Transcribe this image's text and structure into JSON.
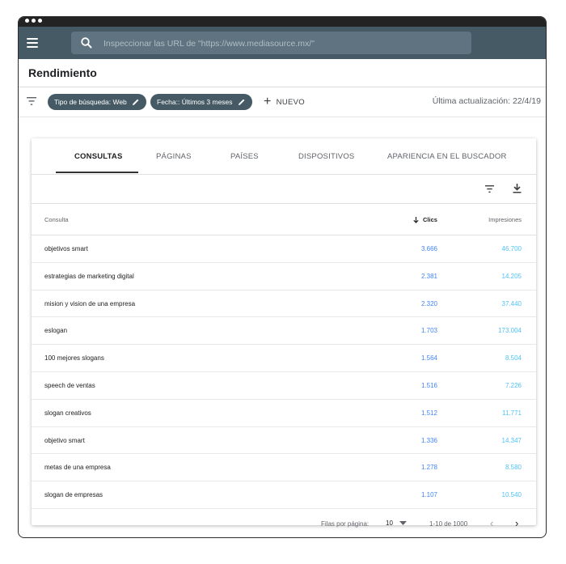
{
  "topbar": {
    "search_placeholder": "Inspeccionar las URL de \"https://www.mediasource.mx/\""
  },
  "header": {
    "title": "Rendimiento"
  },
  "filters": {
    "chips": [
      "Tipo de búsqueda: Web",
      "Fecha:: Últimos 3 meses"
    ],
    "new_label": "NUEVO",
    "last_updated": "Última actualización: 22/4/19"
  },
  "tabs": [
    "CONSULTAS",
    "PÁGINAS",
    "PAÍSES",
    "DISPOSITIVOS",
    "APARIENCIA EN EL BUSCADOR"
  ],
  "table": {
    "columns": {
      "query": "Consulta",
      "clicks": "Clics",
      "impressions": "Impresiones"
    },
    "rows": [
      {
        "query": "objetivos smart",
        "clicks": "3.666",
        "impressions": "46.700"
      },
      {
        "query": "estrategias de marketing digital",
        "clicks": "2.381",
        "impressions": "14.205"
      },
      {
        "query": "mision y vision de una empresa",
        "clicks": "2.320",
        "impressions": "37.440"
      },
      {
        "query": "eslogan",
        "clicks": "1.703",
        "impressions": "173.004"
      },
      {
        "query": "100 mejores slogans",
        "clicks": "1.564",
        "impressions": "8.504"
      },
      {
        "query": "speech de ventas",
        "clicks": "1.516",
        "impressions": "7.226"
      },
      {
        "query": "slogan creativos",
        "clicks": "1.512",
        "impressions": "11.771"
      },
      {
        "query": "objetivo smart",
        "clicks": "1.336",
        "impressions": "14.347"
      },
      {
        "query": "metas de una empresa",
        "clicks": "1.278",
        "impressions": "8.580"
      },
      {
        "query": "slogan de empresas",
        "clicks": "1.107",
        "impressions": "10.540"
      }
    ]
  },
  "pagination": {
    "rows_label": "Filas por página:",
    "rows_value": "10",
    "range": "1-10 de 1000"
  },
  "colors": {
    "topbar": "#455a64",
    "clicks": "#4285f4",
    "impressions": "#4fc3f7"
  }
}
